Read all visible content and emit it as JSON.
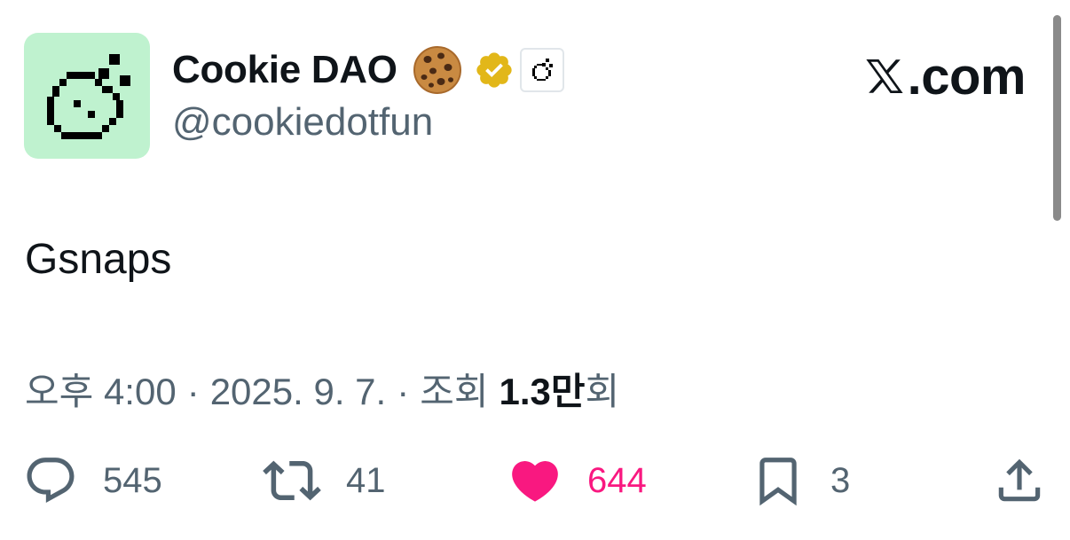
{
  "author": {
    "display_name": "Cookie DAO",
    "handle": "@cookiedotfun",
    "avatar_bg": "#bff2cf",
    "badges": [
      "cookie-emoji",
      "verified-gold-badge",
      "affiliate-badge"
    ]
  },
  "brand": {
    "text": ".com",
    "logo": "x-logo"
  },
  "tweet": {
    "text": "Gsnaps"
  },
  "meta": {
    "time": "오후 4:00",
    "separator": "·",
    "date": "2025. 9. 7.",
    "views_label": "조회",
    "views_count": "1.3만",
    "views_suffix": "회"
  },
  "actions": {
    "replies": "545",
    "reposts": "41",
    "likes": "644",
    "bookmarks": "3"
  },
  "colors": {
    "text_primary": "#0f1419",
    "text_secondary": "#536471",
    "like_pink": "#f91880",
    "verified_gold": "#e2b719"
  }
}
